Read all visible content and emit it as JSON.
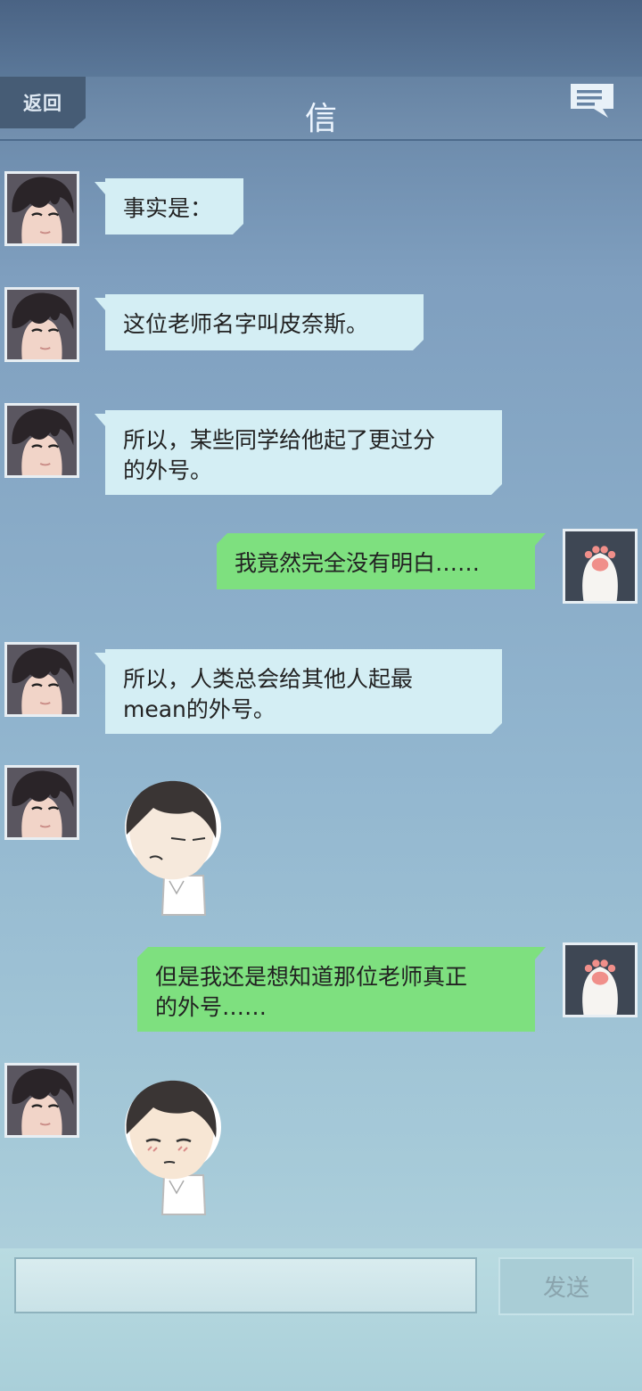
{
  "header": {
    "back_label": "返回",
    "title": "信",
    "icons": {
      "menu": "chat-bubble-icon"
    }
  },
  "colors": {
    "bubble_received": "#d4eef4",
    "bubble_sent": "#7ee07f",
    "header_bg": "#6683a3"
  },
  "messages": [
    {
      "from": "contact",
      "type": "text",
      "text": "事实是："
    },
    {
      "from": "contact",
      "type": "text",
      "text": "这位老师名字叫皮奈斯。"
    },
    {
      "from": "contact",
      "type": "text",
      "line1": "所以，某些同学给他起了更过分",
      "line2": "的外号。"
    },
    {
      "from": "me",
      "type": "text",
      "text": "我竟然完全没有明白……"
    },
    {
      "from": "contact",
      "type": "text",
      "line1": "所以，人类总会给其他人起最",
      "line2": "mean的外号。"
    },
    {
      "from": "contact",
      "type": "sticker",
      "sticker": "boy-sulking-sticker"
    },
    {
      "from": "me",
      "type": "text",
      "line1": "但是我还是想知道那位老师真正",
      "line2": "的外号……"
    },
    {
      "from": "contact",
      "type": "sticker",
      "sticker": "boy-blushing-sticker"
    }
  ],
  "input": {
    "placeholder": "",
    "value": "",
    "send_label": "发送"
  }
}
